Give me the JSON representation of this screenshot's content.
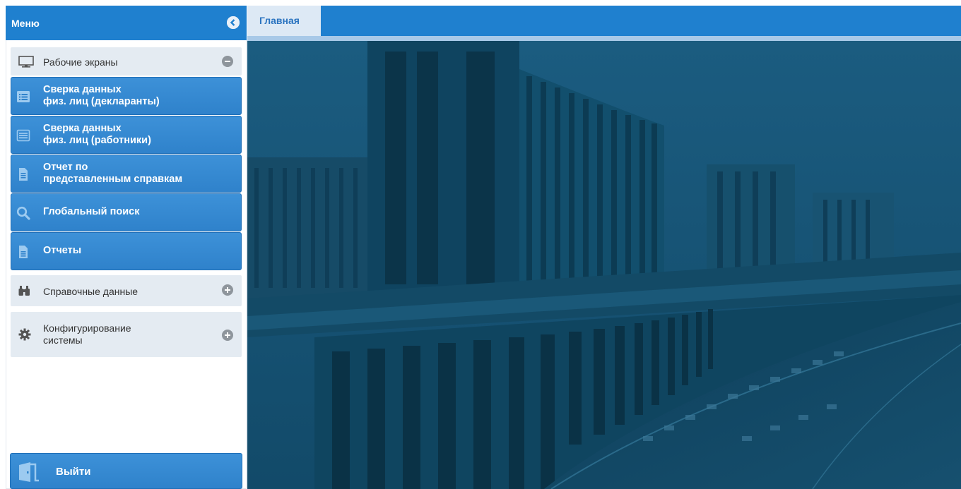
{
  "menu": {
    "title": "Меню",
    "groups": {
      "work_screens": "Рабочие экраны",
      "reference_data": "Справочные данные",
      "config": [
        "Конфигурирование",
        "системы"
      ]
    },
    "items": [
      {
        "lines": [
          "Сверка данных",
          "физ. лиц (декларанты)"
        ],
        "icon": "list-icon"
      },
      {
        "lines": [
          "Сверка данных",
          "физ. лиц (работники)"
        ],
        "icon": "list-icon"
      },
      {
        "lines": [
          "Отчет по",
          "представленным справкам"
        ],
        "icon": "document-icon"
      },
      {
        "lines": [
          "Глобальный поиск"
        ],
        "icon": "search-icon"
      },
      {
        "lines": [
          "Отчеты"
        ],
        "icon": "document-icon"
      }
    ],
    "logout": "Выйти"
  },
  "tabs": [
    {
      "label": "Главная",
      "active": true
    }
  ],
  "colors": {
    "header": "#1f80cf",
    "menu_item": "#2f82cb",
    "group_bg": "#e4ebf2",
    "content_overlay": "#14506f"
  }
}
